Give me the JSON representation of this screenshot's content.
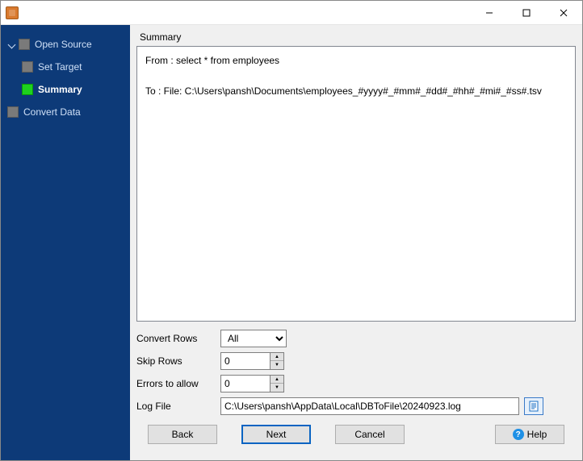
{
  "window": {
    "title": ""
  },
  "sidebar": {
    "items": [
      {
        "label": "Open Source"
      },
      {
        "label": "Set Target"
      },
      {
        "label": "Summary"
      },
      {
        "label": "Convert Data"
      }
    ],
    "active_index": 2
  },
  "main": {
    "summary_label": "Summary",
    "summary_text": "From : select * from employees\n\nTo : File: C:\\Users\\pansh\\Documents\\employees_#yyyy#_#mm#_#dd#_#hh#_#mi#_#ss#.tsv",
    "form": {
      "convert_rows": {
        "label": "Convert Rows",
        "value": "All"
      },
      "skip_rows": {
        "label": "Skip Rows",
        "value": "0"
      },
      "errors_allow": {
        "label": "Errors to allow",
        "value": "0"
      },
      "log_file": {
        "label": "Log File",
        "value": "C:\\Users\\pansh\\AppData\\Local\\DBToFile\\20240923.log"
      }
    }
  },
  "footer": {
    "back": "Back",
    "next": "Next",
    "cancel": "Cancel",
    "help": "Help"
  }
}
